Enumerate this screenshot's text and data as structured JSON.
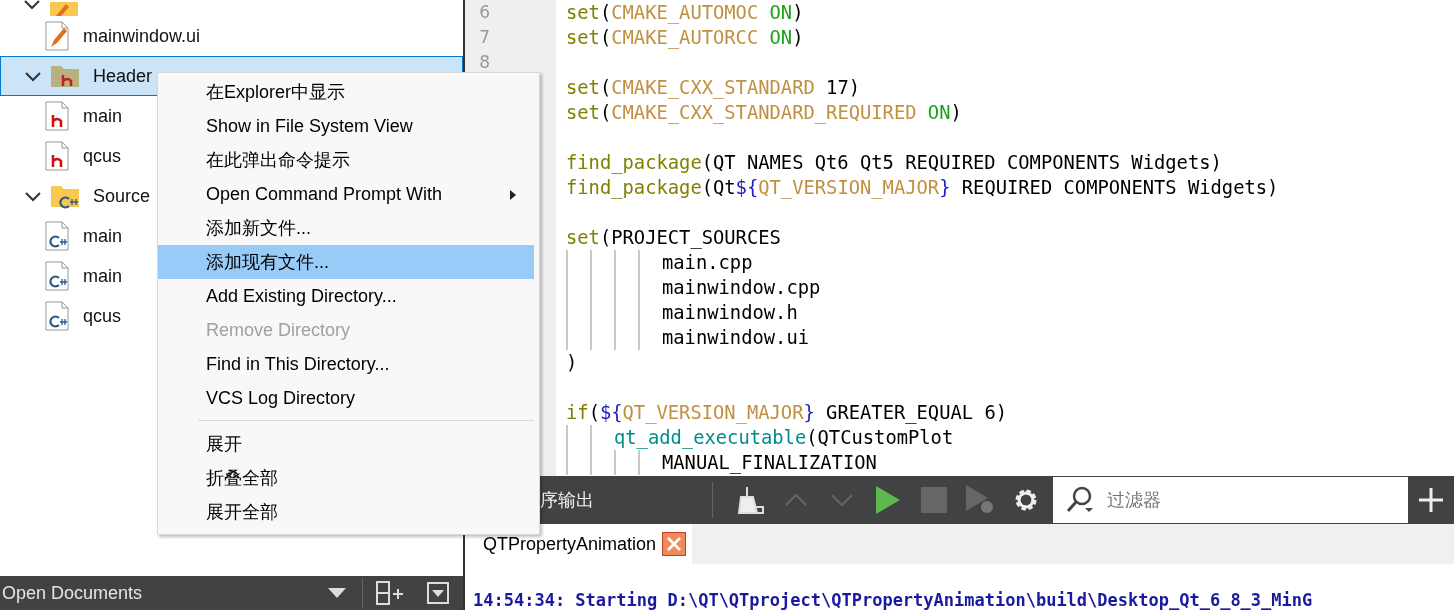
{
  "project_tree": [
    {
      "kind": "forms-folder",
      "expanded": true,
      "children": [
        {
          "kind": "ui-file",
          "label": "mainwindow.ui",
          "selected": false
        }
      ]
    },
    {
      "kind": "header-folder",
      "label": "Header",
      "expanded": true,
      "selected": true,
      "children": [
        {
          "kind": "header-file",
          "label": "main",
          "selected": false
        },
        {
          "kind": "header-file",
          "label": "qcus",
          "selected": false
        }
      ]
    },
    {
      "kind": "source-folder",
      "label": "Source",
      "expanded": true,
      "selected": false,
      "children": [
        {
          "kind": "source-file",
          "label": "main",
          "selected": false
        },
        {
          "kind": "source-file",
          "label": "main",
          "selected": false
        },
        {
          "kind": "source-file",
          "label": "qcus",
          "selected": false
        }
      ]
    }
  ],
  "open_documents": {
    "title": "Open Documents"
  },
  "editor": {
    "lines": [
      {
        "number": "6",
        "tokens": [
          {
            "kind": "keyword",
            "text": "set"
          },
          {
            "kind": "plain",
            "text": "("
          },
          {
            "kind": "variable",
            "text": "CMAKE_AUTOMOC "
          },
          {
            "kind": "constant",
            "text": "ON"
          },
          {
            "kind": "plain",
            "text": ")"
          }
        ]
      },
      {
        "number": "7",
        "tokens": [
          {
            "kind": "keyword",
            "text": "set"
          },
          {
            "kind": "plain",
            "text": "("
          },
          {
            "kind": "variable",
            "text": "CMAKE_AUTORCC "
          },
          {
            "kind": "constant",
            "text": "ON"
          },
          {
            "kind": "plain",
            "text": ")"
          }
        ]
      },
      {
        "number": "8"
      },
      {
        "tokens": [
          {
            "kind": "keyword",
            "text": "set"
          },
          {
            "kind": "plain",
            "text": "("
          },
          {
            "kind": "variable",
            "text": "CMAKE_CXX_STANDARD"
          },
          {
            "kind": "plain",
            "text": " 17)"
          }
        ]
      },
      {
        "tokens": [
          {
            "kind": "keyword",
            "text": "set"
          },
          {
            "kind": "plain",
            "text": "("
          },
          {
            "kind": "variable",
            "text": "CMAKE_CXX_STANDARD_REQUIRED "
          },
          {
            "kind": "constant",
            "text": "ON"
          },
          {
            "kind": "plain",
            "text": ")"
          }
        ]
      },
      {
        "blank_before": true,
        "tokens": [
          {
            "kind": "keyword",
            "text": "find_package"
          },
          {
            "kind": "plain",
            "text": "(QT NAMES Qt6 Qt5 REQUIRED COMPONENTS Widgets)"
          }
        ]
      },
      {
        "tokens": [
          {
            "kind": "keyword",
            "text": "find_package"
          },
          {
            "kind": "plain",
            "text": "(Qt"
          },
          {
            "kind": "brace",
            "text": "${"
          },
          {
            "kind": "variable",
            "text": "QT_VERSION_MAJOR"
          },
          {
            "kind": "brace",
            "text": "}"
          },
          {
            "kind": "plain",
            "text": " REQUIRED COMPONENTS Widgets)"
          }
        ]
      },
      {
        "blank_before": true,
        "tokens": [
          {
            "kind": "keyword",
            "text": "set"
          },
          {
            "kind": "plain",
            "text": "(PROJECT_SOURCES"
          }
        ]
      },
      {
        "tokens": [
          {
            "kind": "plain",
            "text": "        main.cpp"
          }
        ]
      },
      {
        "tokens": [
          {
            "kind": "plain",
            "text": "        mainwindow.cpp"
          }
        ]
      },
      {
        "tokens": [
          {
            "kind": "plain",
            "text": "        mainwindow.h"
          }
        ]
      },
      {
        "tokens": [
          {
            "kind": "plain",
            "text": "        mainwindow.ui"
          }
        ]
      },
      {
        "tokens": [
          {
            "kind": "plain",
            "text": ")"
          }
        ]
      },
      {
        "blank_before": true,
        "tokens": [
          {
            "kind": "keyword",
            "text": "if"
          },
          {
            "kind": "plain",
            "text": "("
          },
          {
            "kind": "brace",
            "text": "${"
          },
          {
            "kind": "variable",
            "text": "QT_VERSION_MAJOR"
          },
          {
            "kind": "brace",
            "text": "}"
          },
          {
            "kind": "plain",
            "text": " GREATER_EQUAL 6)"
          }
        ]
      },
      {
        "tokens": [
          {
            "kind": "function",
            "text": "    qt_add_executable"
          },
          {
            "kind": "plain",
            "text": "(QTCustomPlot"
          }
        ]
      },
      {
        "tokens": [
          {
            "kind": "plain",
            "text": "        MANUAL_FINALIZATION"
          }
        ]
      }
    ]
  },
  "context_menu": [
    {
      "kind": "item",
      "label": "在Explorer中显示",
      "selected": false,
      "disabled": false,
      "submenu": false
    },
    {
      "kind": "item",
      "label": "Show in File System View",
      "selected": false,
      "disabled": false,
      "submenu": false
    },
    {
      "kind": "item",
      "label": "在此弹出命令提示",
      "selected": false,
      "disabled": false,
      "submenu": false
    },
    {
      "kind": "item",
      "label": "Open Command Prompt With",
      "selected": false,
      "disabled": false,
      "submenu": true
    },
    {
      "kind": "item",
      "label": "添加新文件...",
      "selected": false,
      "disabled": false,
      "submenu": false
    },
    {
      "kind": "item",
      "label": "添加现有文件...",
      "selected": true,
      "disabled": false,
      "submenu": false
    },
    {
      "kind": "item",
      "label": "Add Existing Directory...",
      "selected": false,
      "disabled": false,
      "submenu": false
    },
    {
      "kind": "item",
      "label": "Remove Directory",
      "selected": false,
      "disabled": true,
      "submenu": false
    },
    {
      "kind": "item",
      "label": "Find in This Directory...",
      "selected": false,
      "disabled": false,
      "submenu": false
    },
    {
      "kind": "item",
      "label": "VCS Log Directory",
      "selected": false,
      "disabled": false,
      "submenu": false
    },
    {
      "kind": "separator"
    },
    {
      "kind": "item",
      "label": "展开",
      "selected": false,
      "disabled": false,
      "submenu": false
    },
    {
      "kind": "item",
      "label": "折叠全部",
      "selected": false,
      "disabled": false,
      "submenu": false
    },
    {
      "kind": "item",
      "label": "展开全部",
      "selected": false,
      "disabled": false,
      "submenu": false
    }
  ],
  "output_pane": {
    "title": "序输出",
    "filter": {
      "placeholder": "过滤器"
    },
    "tabs": [
      {
        "label": "QTPropertyAnimation",
        "selected": true
      }
    ],
    "lines": [
      "14:54:34: Starting D:\\QT\\QTproject\\QTPropertyAnimation\\build\\Desktop_Qt_6_8_3_MinG"
    ]
  }
}
